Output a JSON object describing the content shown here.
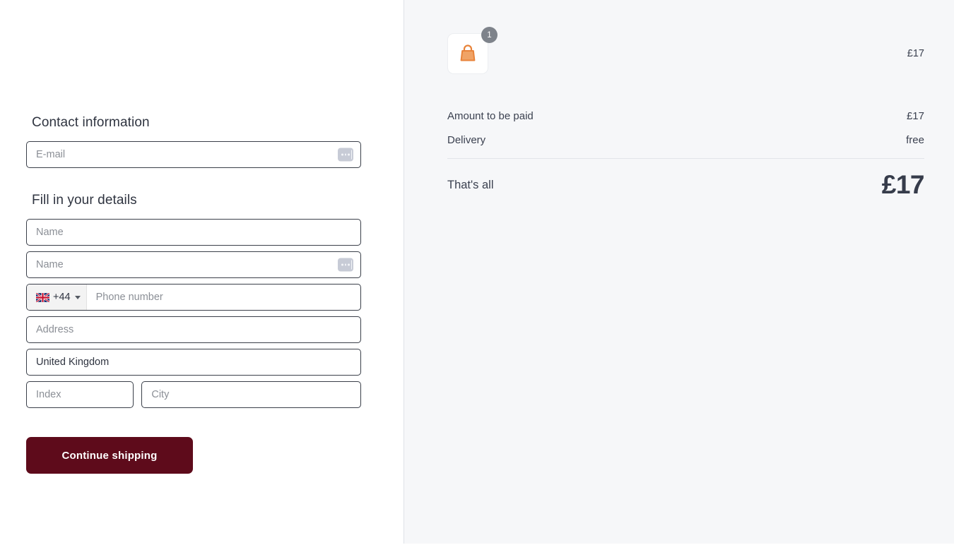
{
  "left": {
    "contact_heading": "Contact information",
    "details_heading": "Fill in your details",
    "fields": {
      "email_placeholder": "E-mail",
      "first_name_placeholder": "Name",
      "last_name_placeholder": "Name",
      "phone_dial_code": "+44",
      "phone_country_flag": "uk-flag-icon",
      "phone_placeholder": "Phone number",
      "address_placeholder": "Address",
      "country_value": "United Kingdom",
      "index_placeholder": "Index",
      "city_placeholder": "City"
    },
    "submit_label": "Continue shipping",
    "submit_color": "#5e0b1b"
  },
  "right": {
    "cart_item": {
      "icon": "shopping-bag-icon",
      "quantity": "1",
      "price": "£17"
    },
    "rows": [
      {
        "label": "Amount to be paid",
        "value": "£17"
      },
      {
        "label": "Delivery",
        "value": "free"
      }
    ],
    "total": {
      "label": "That's all",
      "value": "£17"
    },
    "background": "#f6f7f9"
  },
  "icons": {
    "autofill": "autofill-dots-icon",
    "dropdown": "chevron-down-icon"
  }
}
